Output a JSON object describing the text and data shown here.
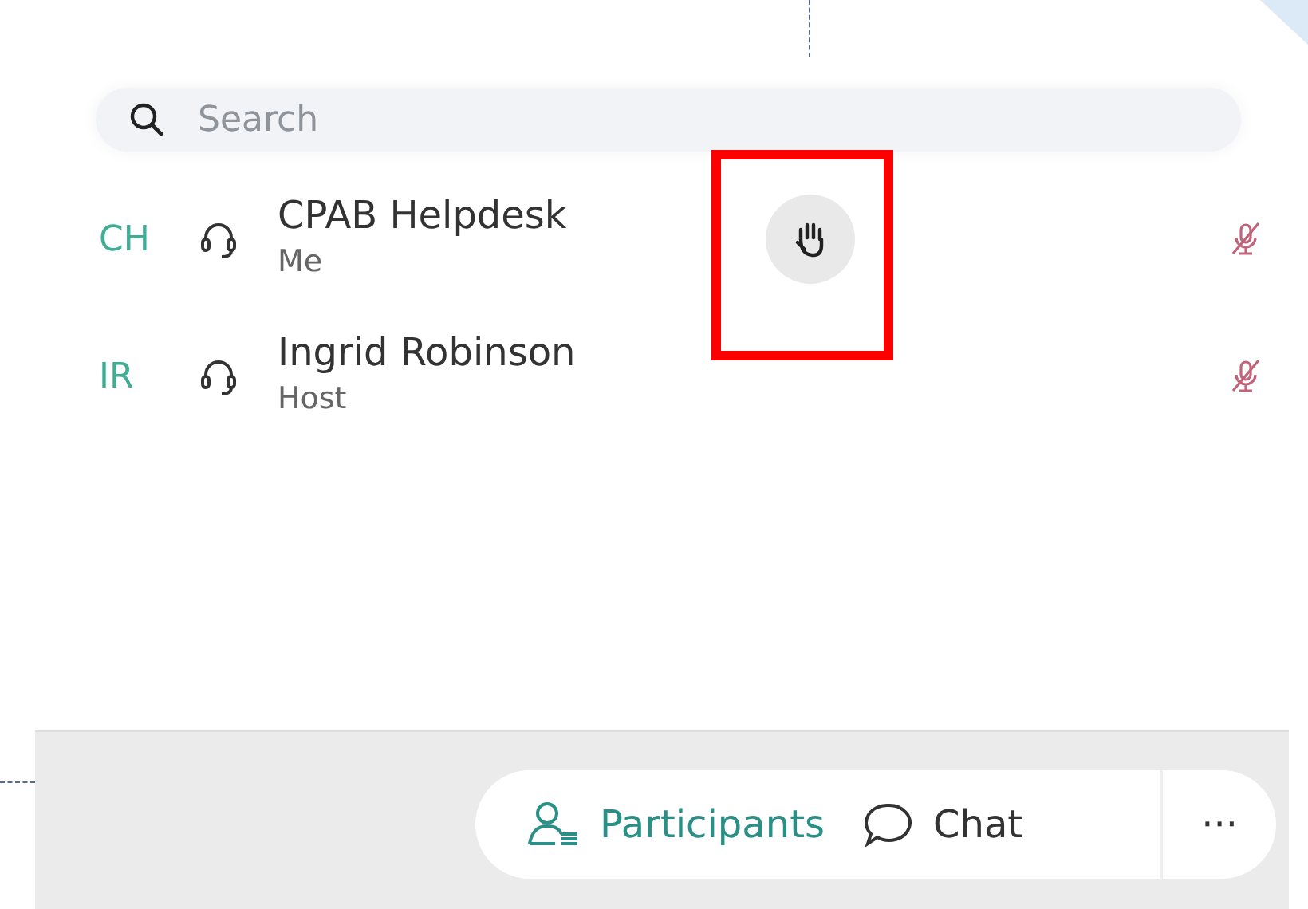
{
  "search": {
    "placeholder": "Search"
  },
  "participants": [
    {
      "initials": "CH",
      "name": "CPAB Helpdesk",
      "role": "Me",
      "hand_raised": true,
      "muted": true
    },
    {
      "initials": "IR",
      "name": "Ingrid Robinson",
      "role": "Host",
      "hand_raised": false,
      "muted": true
    }
  ],
  "toolbar": {
    "tabs": [
      {
        "label": "Participants",
        "kind": "participants",
        "selected": true
      },
      {
        "label": "Chat",
        "kind": "chat",
        "selected": false
      }
    ],
    "more": "···"
  }
}
